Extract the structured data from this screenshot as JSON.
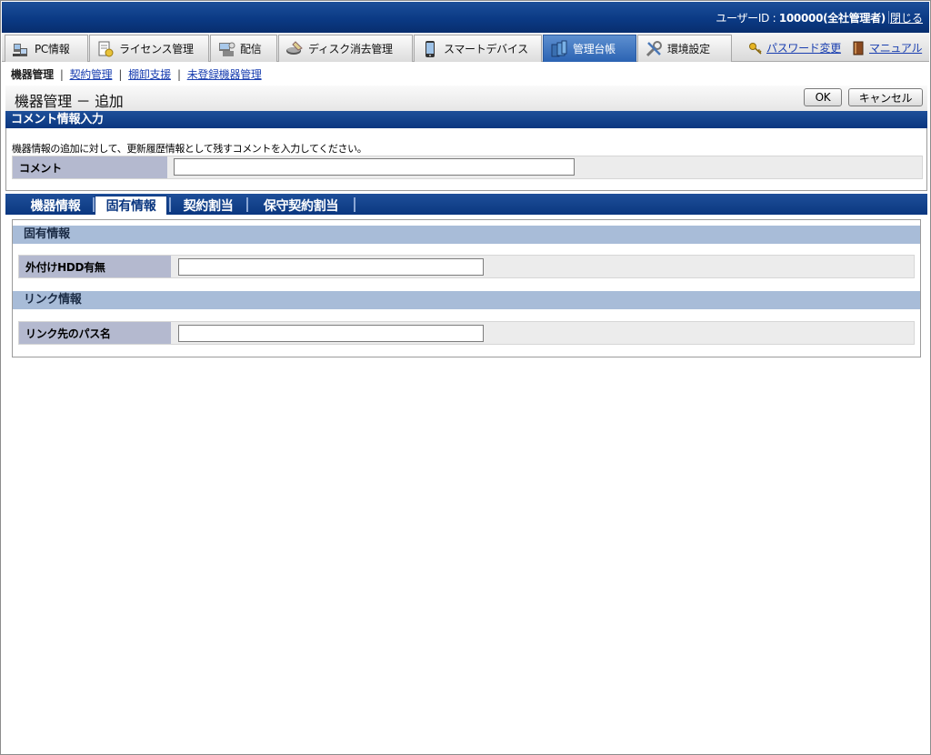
{
  "header": {
    "user_label": "ユーザーID : ",
    "user_value": "100000(全社管理者)",
    "close_label": "閉じる"
  },
  "tabs": [
    {
      "label": "PC情報",
      "icon": "pc-icon"
    },
    {
      "label": "ライセンス管理",
      "icon": "license-icon"
    },
    {
      "label": "配信",
      "icon": "delivery-icon"
    },
    {
      "label": "ディスク消去管理",
      "icon": "disk-erase-icon"
    },
    {
      "label": "スマートデバイス",
      "icon": "smartphone-icon"
    },
    {
      "label": "管理台帳",
      "icon": "ledger-icon",
      "active": true
    },
    {
      "label": "環境設定",
      "icon": "tools-icon"
    }
  ],
  "top_links": {
    "password": "パスワード変更",
    "manual": "マニュアル"
  },
  "subnav": {
    "current": "機器管理",
    "links": [
      "契約管理",
      "棚卸支援",
      "未登録機器管理"
    ]
  },
  "page": {
    "title": "機器管理 － 追加",
    "ok_label": "OK",
    "cancel_label": "キャンセル"
  },
  "comment_section": {
    "heading": "コメント情報入力",
    "description": "機器情報の追加に対して、更新履歴情報として残すコメントを入力してください。",
    "field_label": "コメント",
    "field_value": ""
  },
  "detail_tabs": {
    "items": [
      "機器情報",
      "固有情報",
      "契約割当",
      "保守契約割当"
    ],
    "active_index": 1
  },
  "detail": {
    "group1_title": "固有情報",
    "hdd_label": "外付けHDD有無",
    "hdd_value": "",
    "group2_title": "リンク情報",
    "link_label": "リンク先のパス名",
    "link_value": ""
  },
  "colors": {
    "header_blue": "#0b3a85",
    "active_tab": "#2b63b3",
    "label_bg": "#b4b9cf",
    "group_bg": "#a8bcd8",
    "link": "#1a3fb0"
  }
}
